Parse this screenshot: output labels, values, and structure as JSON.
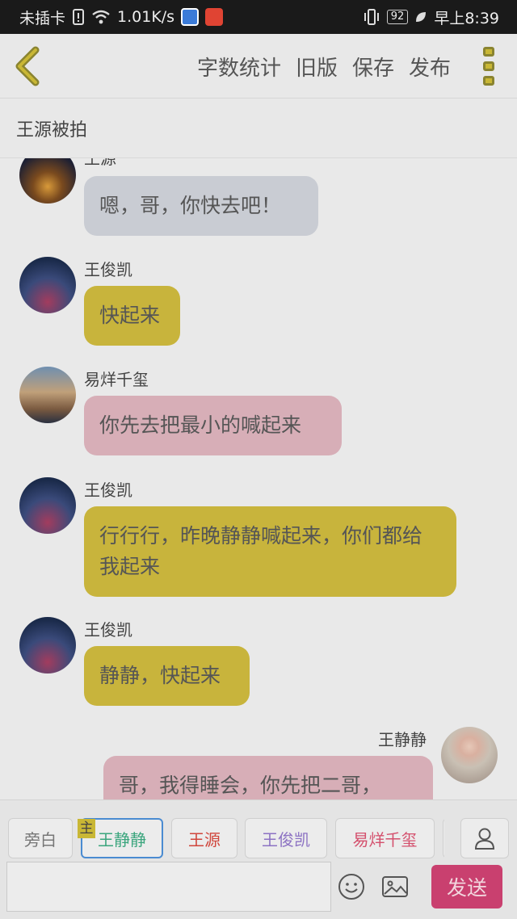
{
  "status_bar": {
    "carrier": "未插卡",
    "speed": "1.01K/s",
    "battery": "92",
    "time": "早上8:39"
  },
  "toolbar": {
    "back_icon": "chevron-left-icon",
    "actions": [
      "字数统计",
      "旧版",
      "保存",
      "发布"
    ],
    "more_icon": "more-vertical-icon"
  },
  "title": "王源被拍",
  "messages": [
    {
      "sender": "王源",
      "text": "嗯，哥，你快去吧！",
      "side": "left",
      "color": "gray"
    },
    {
      "sender": "王俊凯",
      "text": "快起来",
      "side": "left",
      "color": "gold"
    },
    {
      "sender": "易烊千玺",
      "text": "你先去把最小的喊起来",
      "side": "left",
      "color": "pink"
    },
    {
      "sender": "王俊凯",
      "text": "行行行，昨晚静静喊起来，你们都给我起来",
      "side": "left",
      "color": "gold"
    },
    {
      "sender": "王俊凯",
      "text": "静静，快起来",
      "side": "left",
      "color": "gold"
    },
    {
      "sender": "王静静",
      "text": "哥，我得睡会，你先把二哥，",
      "side": "right",
      "color": "pink"
    }
  ],
  "roles": [
    {
      "label": "旁白",
      "color": "#777777"
    },
    {
      "label": "王静静",
      "color": "#3aa57d",
      "active": true,
      "tag": "主"
    },
    {
      "label": "王源",
      "color": "#d0453b"
    },
    {
      "label": "王俊凯",
      "color": "#8c72c3"
    },
    {
      "label": "易烊千玺",
      "color": "#d4506d"
    }
  ],
  "input": {
    "placeholder": ""
  },
  "send_label": "发送",
  "colors": {
    "accent_gold": "#c8b43c",
    "bubble_pink": "#d7aeb7",
    "bubble_gray": "#c9ccd3",
    "send": "#c9406f"
  }
}
